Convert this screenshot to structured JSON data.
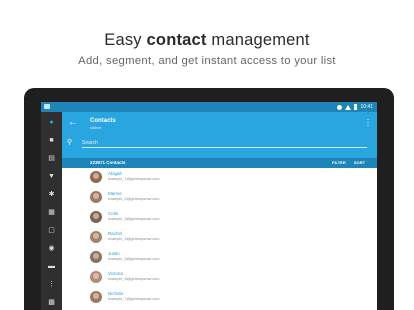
{
  "promo": {
    "headline_pre": "Easy ",
    "headline_bold": "contact",
    "headline_post": " management",
    "subline": "Add, segment, and get instant access to your list"
  },
  "status_bar": {
    "time": "10:41"
  },
  "rail": {
    "icons": [
      "contacts-icon",
      "mail-icon",
      "list-icon",
      "filter-icon",
      "settings-icon",
      "calendar-icon",
      "document-icon",
      "location-icon",
      "folder-icon",
      "sliders-icon",
      "grid-icon"
    ]
  },
  "app_bar": {
    "title": "Contacts",
    "subtitle": "sildme",
    "search_placeholder": "Search"
  },
  "count_bar": {
    "count_label": "223671 Contacts",
    "filter_label": "FILTER",
    "sort_label": "SORT"
  },
  "contacts": [
    {
      "name": "Abigail",
      "email": "example_1@getresponse.com",
      "avatar_color": "#8e6a55"
    },
    {
      "name": "Marnie",
      "email": "example_2@getresponse.com",
      "avatar_color": "#9c7b66"
    },
    {
      "name": "Colin",
      "email": "example_3@getresponse.com",
      "avatar_color": "#7e6553"
    },
    {
      "name": "Rachel",
      "email": "example_4@getresponse.com",
      "avatar_color": "#a3826c"
    },
    {
      "name": "Justin",
      "email": "example_5@getresponse.com",
      "avatar_color": "#8a7261"
    },
    {
      "name": "Victoria",
      "email": "example_6@getresponse.com",
      "avatar_color": "#b08c78"
    },
    {
      "name": "Nichola",
      "email": "example_7@getresponse.com",
      "avatar_color": "#9a7a64"
    }
  ],
  "colors": {
    "app_bar": "#29a6e0",
    "status_bar": "#1d85b8",
    "rail": "#2f2f2f",
    "accent": "#2a9ed8",
    "device": "#1f1f1f"
  }
}
